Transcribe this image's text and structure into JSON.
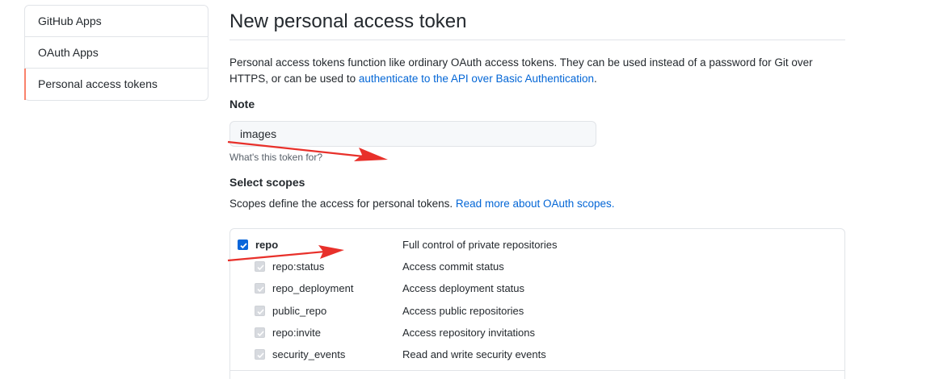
{
  "sidebar": {
    "items": [
      {
        "label": "GitHub Apps"
      },
      {
        "label": "OAuth Apps"
      },
      {
        "label": "Personal access tokens"
      }
    ]
  },
  "main": {
    "title": "New personal access token",
    "intro_text": "Personal access tokens function like ordinary OAuth access tokens. They can be used instead of a password for Git over HTTPS, or can be used to ",
    "intro_link": "authenticate to the API over Basic Authentication",
    "intro_end": ".",
    "note_label": "Note",
    "note_value": "images",
    "note_hint": "What's this token for?",
    "scopes_title": "Select scopes",
    "scopes_desc_text": "Scopes define the access for personal tokens. ",
    "scopes_desc_link": "Read more about OAuth scopes."
  },
  "scopes": [
    {
      "name": "repo",
      "description": "Full control of private repositories",
      "checked": true,
      "disabled": false
    },
    {
      "name": "repo:status",
      "description": "Access commit status",
      "checked": true,
      "disabled": true
    },
    {
      "name": "repo_deployment",
      "description": "Access deployment status",
      "checked": true,
      "disabled": true
    },
    {
      "name": "public_repo",
      "description": "Access public repositories",
      "checked": true,
      "disabled": true
    },
    {
      "name": "repo:invite",
      "description": "Access repository invitations",
      "checked": true,
      "disabled": true
    },
    {
      "name": "security_events",
      "description": "Read and write security events",
      "checked": true,
      "disabled": true
    }
  ],
  "colors": {
    "link": "#0366d6",
    "selected_indicator": "#f9826c",
    "checkbox": "#0a66da",
    "annotation_arrow": "#e8302a"
  }
}
